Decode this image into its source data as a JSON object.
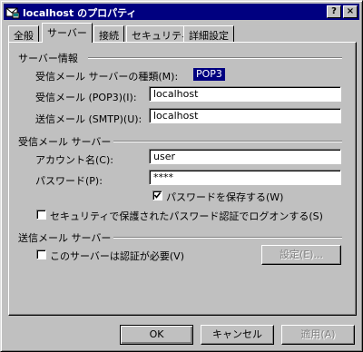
{
  "window": {
    "title": "localhost のプロパティ",
    "help_label": "?",
    "close_label": "×"
  },
  "tabs": [
    {
      "label": "全般",
      "active": false
    },
    {
      "label": "サーバー",
      "active": true
    },
    {
      "label": "接続",
      "active": false
    },
    {
      "label": "セキュリティ",
      "active": false
    },
    {
      "label": "詳細設定",
      "active": false
    }
  ],
  "server_info": {
    "title": "サーバー情報",
    "incoming_type_label": "受信メール サーバーの種類(M):",
    "incoming_type_value": "POP3",
    "incoming_label": "受信メール (POP3)(I):",
    "incoming_value": "localhost",
    "outgoing_label": "送信メール (SMTP)(U):",
    "outgoing_value": "localhost"
  },
  "incoming_server": {
    "title": "受信メール サーバー",
    "account_label": "アカウント名(C):",
    "account_value": "user",
    "password_label": "パスワード(P):",
    "password_value": "****",
    "save_password_label": "パスワードを保存する(W)",
    "save_password_checked": true,
    "spa_label": "セキュリティで保護されたパスワード認証でログオンする(S)",
    "spa_checked": false
  },
  "outgoing_server": {
    "title": "送信メール サーバー",
    "auth_label": "このサーバーは認証が必要(V)",
    "auth_checked": false,
    "settings_label": "設定(E)..."
  },
  "buttons": {
    "ok": "OK",
    "cancel": "キャンセル",
    "apply": "適用(A)"
  }
}
